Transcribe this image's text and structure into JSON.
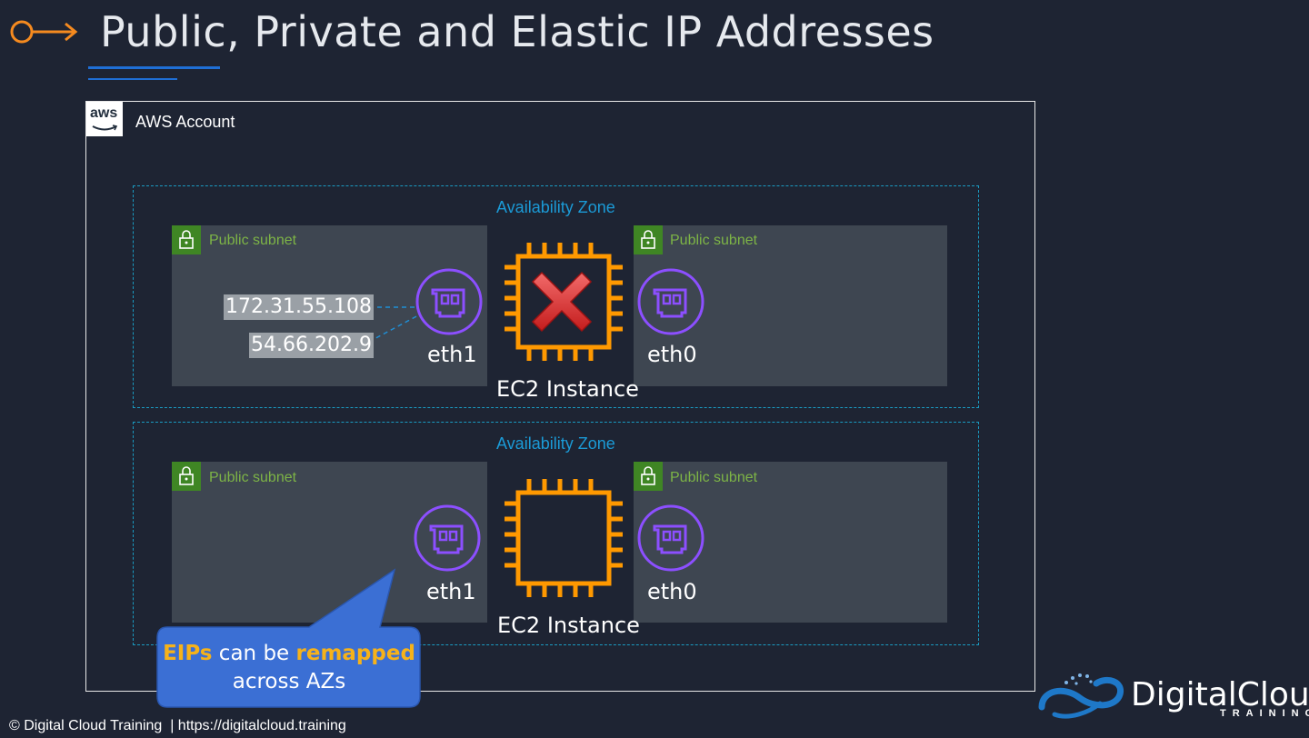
{
  "title": "Public, Private and Elastic IP Addresses",
  "account": {
    "logo_text": "aws",
    "label": "AWS Account"
  },
  "zones": [
    {
      "label": "Availability Zone",
      "left_subnet": "Public subnet",
      "right_subnet": "Public subnet",
      "ips": [
        "172.31.55.108",
        "54.66.202.9"
      ],
      "eni_left": "eth1",
      "eni_right": "eth0",
      "instance": "EC2 Instance",
      "instance_failed": true
    },
    {
      "label": "Availability Zone",
      "left_subnet": "Public subnet",
      "right_subnet": "Public subnet",
      "eni_left": "eth1",
      "eni_right": "eth0",
      "instance": "EC2 Instance",
      "instance_failed": false
    }
  ],
  "callout": {
    "part1": "EIPs",
    "part2": " can be ",
    "part3": "remapped",
    "line2": "across AZs"
  },
  "footer": "© Digital Cloud Training  | https://digitalcloud.training",
  "brand": {
    "name": "DigitalCloud",
    "tagline": "TRAINING"
  },
  "colors": {
    "background": "#1e2433",
    "chip_orange": "#ff9900",
    "eni_purple": "#8c4fff",
    "subnet_green": "#7db446",
    "az_blue": "#1a9bc2",
    "callout_blue": "#3b6fd4",
    "highlight": "#f6b21a"
  },
  "icons": [
    "arrow-right-icon",
    "aws-logo-icon",
    "lock-icon",
    "network-interface-icon",
    "ec2-chip-icon",
    "red-x-icon",
    "digitalcloud-logo-icon"
  ]
}
